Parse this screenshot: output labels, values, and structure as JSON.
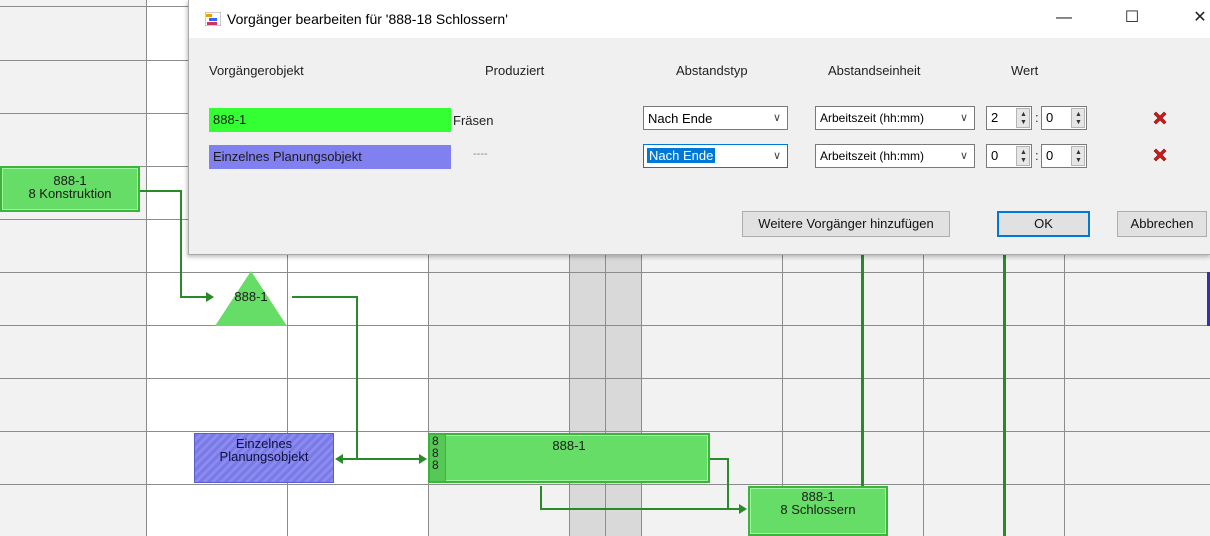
{
  "dialog": {
    "title": "Vorgänger bearbeiten für '888-18  Schlossern'",
    "window_controls": {
      "minimize": "—",
      "maximize": "☐",
      "close": "✕"
    },
    "headers": {
      "predecessor": "Vorgängerobjekt",
      "produced": "Produziert",
      "gap_type": "Abstandstyp",
      "gap_unit": "Abstandseinheit",
      "value": "Wert"
    },
    "rows": [
      {
        "object": "888-1",
        "object_color": "#33ff33",
        "produced": "Fräsen",
        "gap_type": "Nach Ende",
        "gap_unit": "Arbeitszeit (hh:mm)",
        "hours": "2",
        "minutes": "0",
        "gap_type_focused": false
      },
      {
        "object": "Einzelnes Planungsobjekt",
        "object_color": "#8080f0",
        "produced": "----",
        "gap_type": "Nach Ende",
        "gap_unit": "Arbeitszeit (hh:mm)",
        "hours": "0",
        "minutes": "0",
        "gap_type_focused": true
      }
    ],
    "time_separator": ":",
    "buttons": {
      "add_more": "Weitere Vorgänger hinzufügen",
      "ok": "OK",
      "cancel": "Abbrechen"
    }
  },
  "gantt": {
    "tasks": {
      "konstruktion": {
        "line1": "888-1",
        "line2": "8  Konstruktion"
      },
      "milestone": {
        "label": "888-1"
      },
      "planungsobjekt": {
        "line1": "Einzelnes",
        "line2": "Planungsobjekt"
      },
      "main_bar": {
        "label": "888-1",
        "side1": "8",
        "side2": "8",
        "side3": "8"
      },
      "schlossern": {
        "line1": "888-1",
        "line2": "8  Schlossern"
      }
    }
  },
  "colors": {
    "accent": "#0078d7",
    "task_green": "#66dd66",
    "task_blue": "#8080f0",
    "connector": "#2a8a2a",
    "delete_red": "#cc1b1b"
  }
}
